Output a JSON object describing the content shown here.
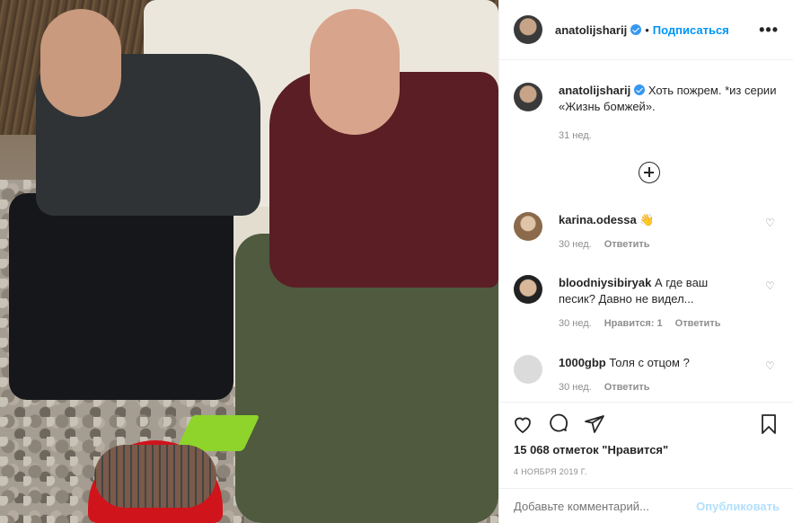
{
  "post": {
    "author": "anatolijsharij",
    "follow_label": "Подписаться",
    "more_label": "•••",
    "caption_text": "Хоть пожрем. *из серии «Жизнь бомжей».",
    "caption_time": "31 нед."
  },
  "comments": [
    {
      "user": "karina.odessa",
      "text": "👋",
      "time": "30 нед.",
      "likes": "",
      "reply": "Ответить"
    },
    {
      "user": "bloodniysibiryak",
      "text": "А где ваш песик? Давно не видел...",
      "time": "30 нед.",
      "likes": "Нравится: 1",
      "reply": "Ответить"
    },
    {
      "user": "1000gbp",
      "text": "Толя с отцом ?",
      "time": "30 нед.",
      "likes": "",
      "reply": "Ответить"
    }
  ],
  "actions": {
    "likes_text": "15 068 отметок \"Нравится\"",
    "date": "4 НОЯБРЯ 2019 Г."
  },
  "add_comment": {
    "placeholder": "Добавьте комментарий...",
    "post_label": "Опубликовать"
  },
  "colors": {
    "accent": "#0095f6",
    "verified": "#3897f0",
    "muted": "#8e8e8e"
  }
}
